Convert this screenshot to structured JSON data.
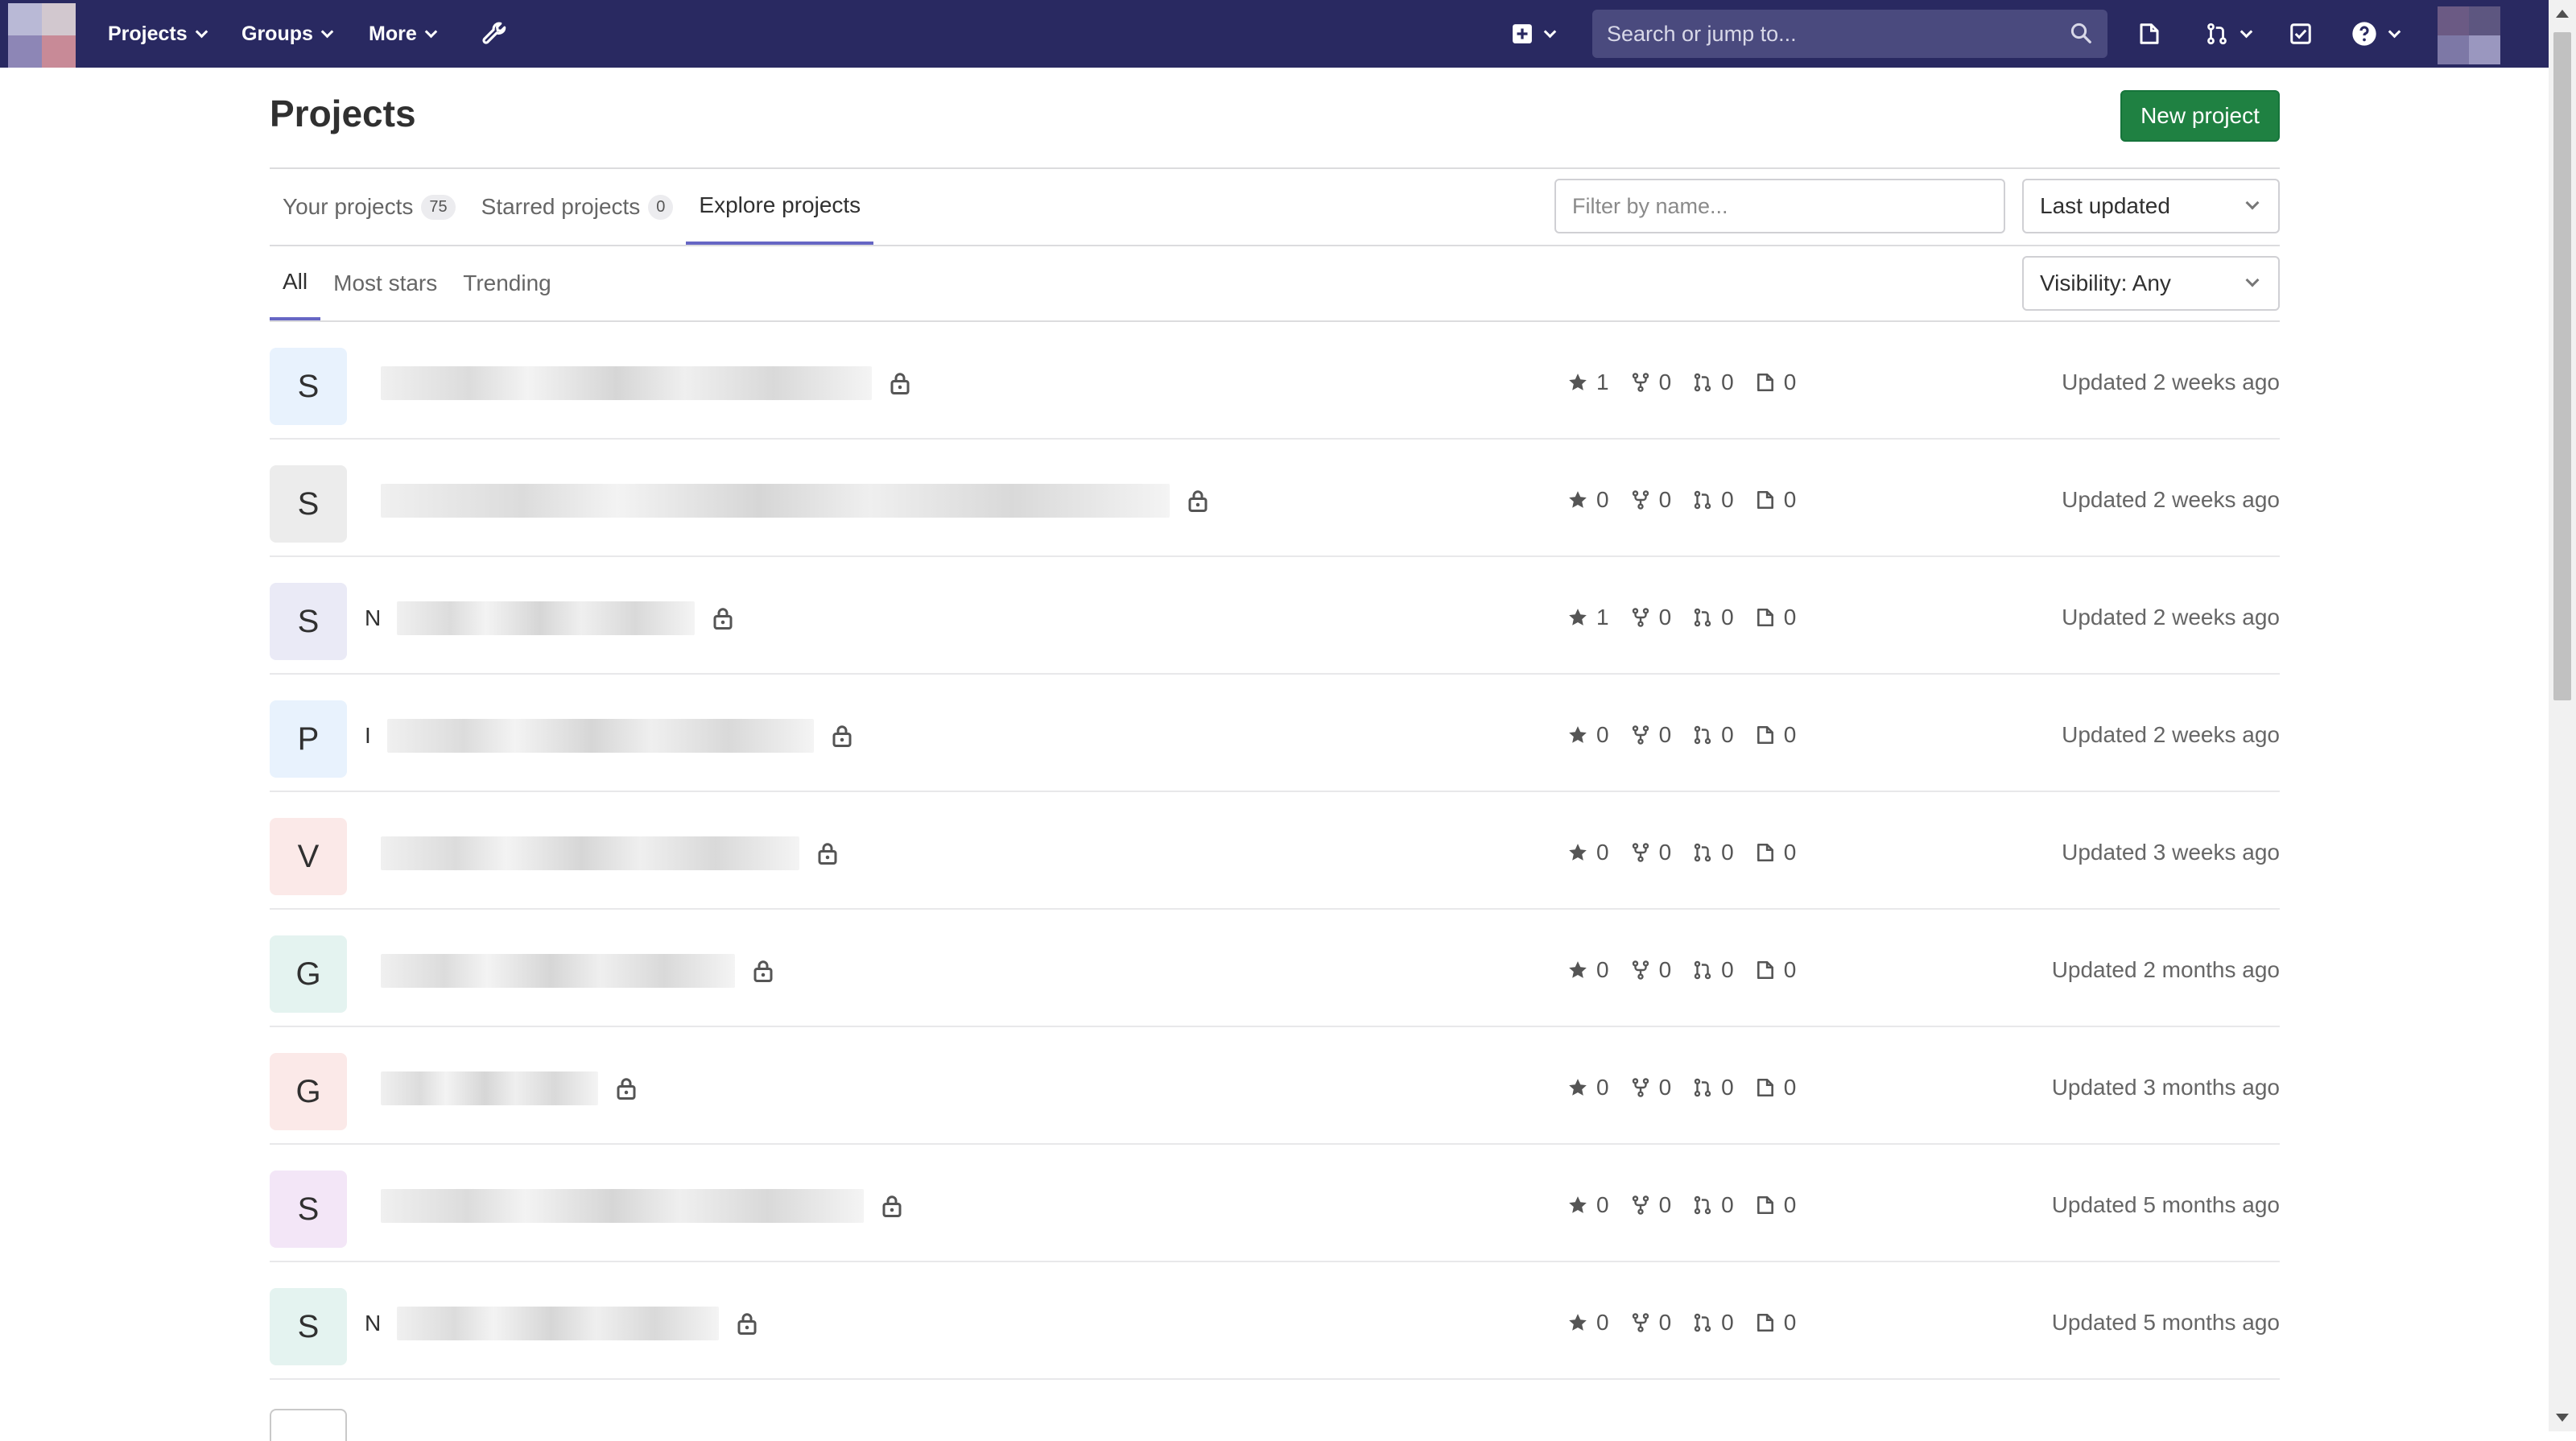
{
  "navbar": {
    "projects_label": "Projects",
    "groups_label": "Groups",
    "more_label": "More",
    "search_placeholder": "Search or jump to...",
    "colors": {
      "background": "#292961",
      "search_bg": "#4a4a7e"
    },
    "icons": [
      "wrench-icon",
      "plus-square-icon",
      "todo-issue-icon",
      "merge-request-icon",
      "checklist-icon",
      "help-icon",
      "search-icon"
    ]
  },
  "page": {
    "title": "Projects",
    "new_project_label": "New project",
    "accent_color": "#1f8142"
  },
  "tabs": [
    {
      "label": "Your projects",
      "count": "75"
    },
    {
      "label": "Starred projects",
      "count": "0"
    },
    {
      "label": "Explore projects",
      "count": null
    }
  ],
  "filter": {
    "placeholder": "Filter by name...",
    "sort_value": "Last updated",
    "visibility_value": "Visibility: Any"
  },
  "subtabs": [
    "All",
    "Most stars",
    "Trending"
  ],
  "projects": [
    {
      "letter": "S",
      "name_prefix": "",
      "stars": "1",
      "forks": "0",
      "mrs": "0",
      "issues": "0",
      "updated": "Updated 2 weeks ago",
      "avatar_bg": "#e8f2fd"
    },
    {
      "letter": "S",
      "name_prefix": "",
      "stars": "0",
      "forks": "0",
      "mrs": "0",
      "issues": "0",
      "updated": "Updated 2 weeks ago",
      "avatar_bg": "#ececec"
    },
    {
      "letter": "S",
      "name_prefix": "N",
      "stars": "1",
      "forks": "0",
      "mrs": "0",
      "issues": "0",
      "updated": "Updated 2 weeks ago",
      "avatar_bg": "#eaeaf6"
    },
    {
      "letter": "P",
      "name_prefix": "I",
      "stars": "0",
      "forks": "0",
      "mrs": "0",
      "issues": "0",
      "updated": "Updated 2 weeks ago",
      "avatar_bg": "#e8f2fd"
    },
    {
      "letter": "V",
      "name_prefix": "",
      "stars": "0",
      "forks": "0",
      "mrs": "0",
      "issues": "0",
      "updated": "Updated 3 weeks ago",
      "avatar_bg": "#fbe9e8"
    },
    {
      "letter": "G",
      "name_prefix": "",
      "stars": "0",
      "forks": "0",
      "mrs": "0",
      "issues": "0",
      "updated": "Updated 2 months ago",
      "avatar_bg": "#e4f3f0"
    },
    {
      "letter": "G",
      "name_prefix": "",
      "stars": "0",
      "forks": "0",
      "mrs": "0",
      "issues": "0",
      "updated": "Updated 3 months ago",
      "avatar_bg": "#fbe9e8"
    },
    {
      "letter": "S",
      "name_prefix": "",
      "stars": "0",
      "forks": "0",
      "mrs": "0",
      "issues": "0",
      "updated": "Updated 5 months ago",
      "avatar_bg": "#f3e6f7"
    },
    {
      "letter": "S",
      "name_prefix": "N",
      "stars": "0",
      "forks": "0",
      "mrs": "0",
      "issues": "0",
      "updated": "Updated 5 months ago",
      "avatar_bg": "#e4f3f0"
    }
  ]
}
